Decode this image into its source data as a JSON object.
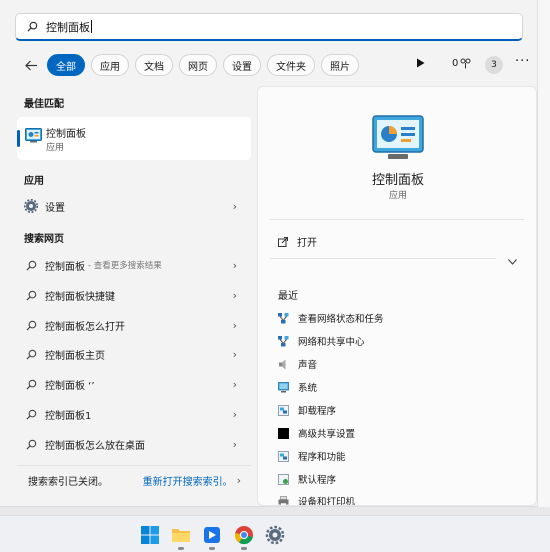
{
  "search": {
    "query": "控制面板"
  },
  "filters": {
    "chips": [
      "全部",
      "应用",
      "文档",
      "网页",
      "设置",
      "文件夹",
      "照片"
    ],
    "points": "0",
    "badge": "3"
  },
  "best_match": {
    "heading": "最佳匹配",
    "title": "控制面板",
    "subtitle": "应用"
  },
  "apps": {
    "heading": "应用",
    "items": [
      {
        "label": "设置"
      }
    ]
  },
  "web": {
    "heading": "搜索网页",
    "items": [
      {
        "label": "控制面板",
        "sub": "- 查看更多搜索结果"
      },
      {
        "label": "控制面板快捷键"
      },
      {
        "label": "控制面板怎么打开"
      },
      {
        "label": "控制面板主页"
      },
      {
        "label": "控制面板 ‘’"
      },
      {
        "label": "控制面板1"
      },
      {
        "label": "控制面板怎么放在桌面"
      }
    ]
  },
  "footer": {
    "status": "搜索索引已关闭。",
    "link": "重新打开搜索索引。"
  },
  "detail": {
    "title": "控制面板",
    "subtitle": "应用",
    "open_label": "打开",
    "recent_heading": "最近",
    "recent": [
      {
        "label": "查看网络状态和任务",
        "icon": "network-icon"
      },
      {
        "label": "网络和共享中心",
        "icon": "network-icon"
      },
      {
        "label": "声音",
        "icon": "speaker-icon"
      },
      {
        "label": "系统",
        "icon": "system-icon"
      },
      {
        "label": "卸载程序",
        "icon": "programs-icon"
      },
      {
        "label": "高级共享设置",
        "icon": "black-square-icon"
      },
      {
        "label": "程序和功能",
        "icon": "programs-icon"
      },
      {
        "label": "默认程序",
        "icon": "default-programs-icon"
      },
      {
        "label": "设备和打印机",
        "icon": "printer-icon"
      }
    ]
  },
  "colors": {
    "accent": "#005fb8",
    "chip_active": "#0067c0",
    "link": "#0067c0"
  }
}
